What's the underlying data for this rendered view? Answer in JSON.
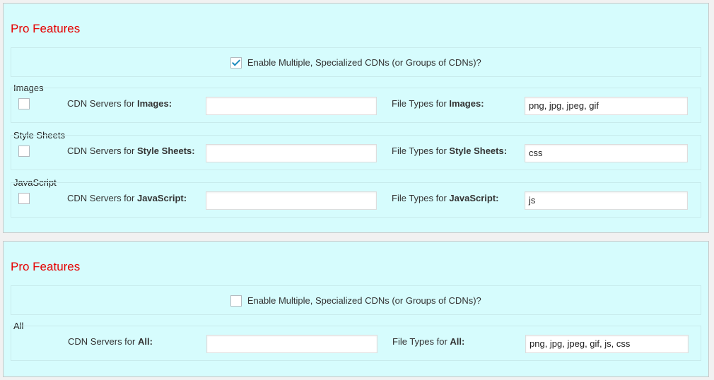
{
  "panels": [
    {
      "title": "Pro Features",
      "enable_label": "Enable Multiple, Specialized CDNs (or Groups of CDNs)?",
      "enable_checked": true,
      "groups": [
        {
          "legend": "Images",
          "servers_label_prefix": "CDN Servers for ",
          "servers_label_bold": "Images:",
          "servers_value": "",
          "types_label_prefix": "File Types for ",
          "types_label_bold": "Images:",
          "types_value": "png, jpg, jpeg, gif"
        },
        {
          "legend": "Style Sheets",
          "servers_label_prefix": "CDN Servers for ",
          "servers_label_bold": "Style Sheets:",
          "servers_value": "",
          "types_label_prefix": "File Types for ",
          "types_label_bold": "Style Sheets:",
          "types_value": "css"
        },
        {
          "legend": "JavaScript",
          "servers_label_prefix": "CDN Servers for ",
          "servers_label_bold": "JavaScript:",
          "servers_value": "",
          "types_label_prefix": "File Types for ",
          "types_label_bold": "JavaScript:",
          "types_value": "js"
        }
      ]
    },
    {
      "title": "Pro Features",
      "enable_label": "Enable Multiple, Specialized CDNs (or Groups of CDNs)?",
      "enable_checked": false,
      "groups": [
        {
          "legend": "All",
          "servers_label_prefix": "CDN Servers for ",
          "servers_label_bold": "All:",
          "servers_value": "",
          "types_label_prefix": "File Types for ",
          "types_label_bold": "All:",
          "types_value": "png, jpg, jpeg, gif, js, css"
        }
      ]
    }
  ],
  "colors": {
    "title": "#e60000",
    "panel_bg": "#d6fcfd",
    "check": "#1e8cbe"
  }
}
